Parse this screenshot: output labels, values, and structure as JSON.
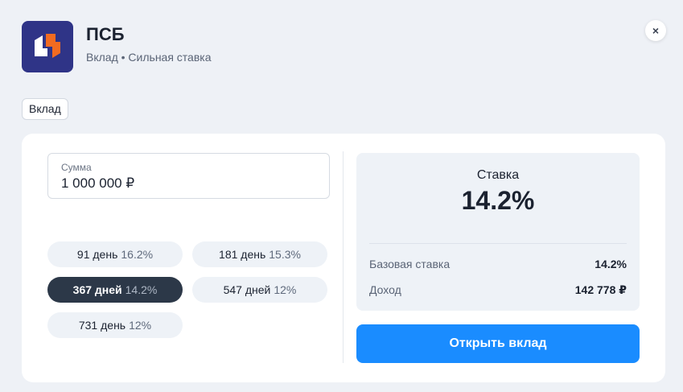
{
  "header": {
    "bank_name": "ПСБ",
    "subtitle": "Вклад • Сильная ставка",
    "close_icon": "×",
    "logo_colors": {
      "background": "#2f3487",
      "accent": "#f26b21",
      "white": "#ffffff"
    }
  },
  "tag": {
    "label": "Вклад"
  },
  "form": {
    "amount_label": "Сумма",
    "amount_value": "1 000 000 ₽"
  },
  "terms": [
    {
      "days": "91 день",
      "rate": "16.2%",
      "selected": false
    },
    {
      "days": "181 день",
      "rate": "15.3%",
      "selected": false
    },
    {
      "days": "367 дней",
      "rate": "14.2%",
      "selected": true
    },
    {
      "days": "547 дней",
      "rate": "12%",
      "selected": false
    },
    {
      "days": "731 день",
      "rate": "12%",
      "selected": false
    }
  ],
  "summary": {
    "title": "Ставка",
    "rate": "14.2%",
    "base_rate_label": "Базовая ставка",
    "base_rate_value": "14.2%",
    "income_label": "Доход",
    "income_value": "142 778 ₽"
  },
  "cta": {
    "label": "Открыть вклад",
    "color": "#1a8cff"
  }
}
